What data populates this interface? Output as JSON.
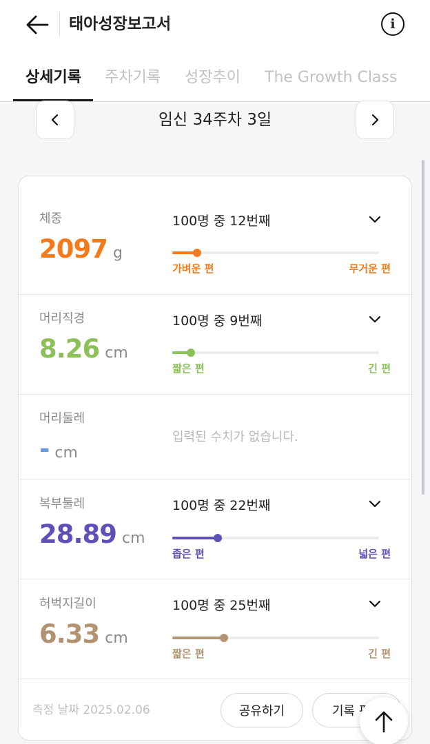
{
  "header": {
    "title": "태아성장보고서"
  },
  "tabs": [
    "상세기록",
    "주차기록",
    "성장추이",
    "The Growth Class"
  ],
  "active_tab": 0,
  "week_nav": {
    "label": "임신 34주차 3일"
  },
  "metrics": [
    {
      "label": "체중",
      "value": "2097",
      "unit": "g",
      "color": "#f57a1b",
      "rank_text": "100명 중 12번째",
      "rank_fraction": 0.12,
      "low_label": "가벼운 편",
      "high_label": "무거운 편"
    },
    {
      "label": "머리직경",
      "value": "8.26",
      "unit": "cm",
      "color": "#8cc05a",
      "rank_text": "100명 중 9번째",
      "rank_fraction": 0.09,
      "low_label": "짧은 편",
      "high_label": "긴 편"
    },
    {
      "label": "머리둘레",
      "value": "-",
      "unit": "cm",
      "color": "#6a9be0",
      "empty_text": "입력된 수치가 없습니다."
    },
    {
      "label": "복부둘레",
      "value": "28.89",
      "unit": "cm",
      "color": "#5e52b8",
      "rank_text": "100명 중 22번째",
      "rank_fraction": 0.22,
      "low_label": "좁은 편",
      "high_label": "넓은 편"
    },
    {
      "label": "허벅지길이",
      "value": "6.33",
      "unit": "cm",
      "color": "#b29472",
      "rank_text": "100명 중 25번째",
      "rank_fraction": 0.25,
      "low_label": "짧은 편",
      "high_label": "긴 편"
    }
  ],
  "footer": {
    "date": "측정 날짜 2025.02.06",
    "share_label": "공유하기",
    "edit_label": "기록 편"
  },
  "icons": {
    "back": "arrow-left-icon",
    "info": "info-circle-icon",
    "prev": "chevron-left-icon",
    "next": "chevron-right-icon",
    "expand": "chevron-down-icon",
    "scroll_top": "arrow-up-icon"
  }
}
